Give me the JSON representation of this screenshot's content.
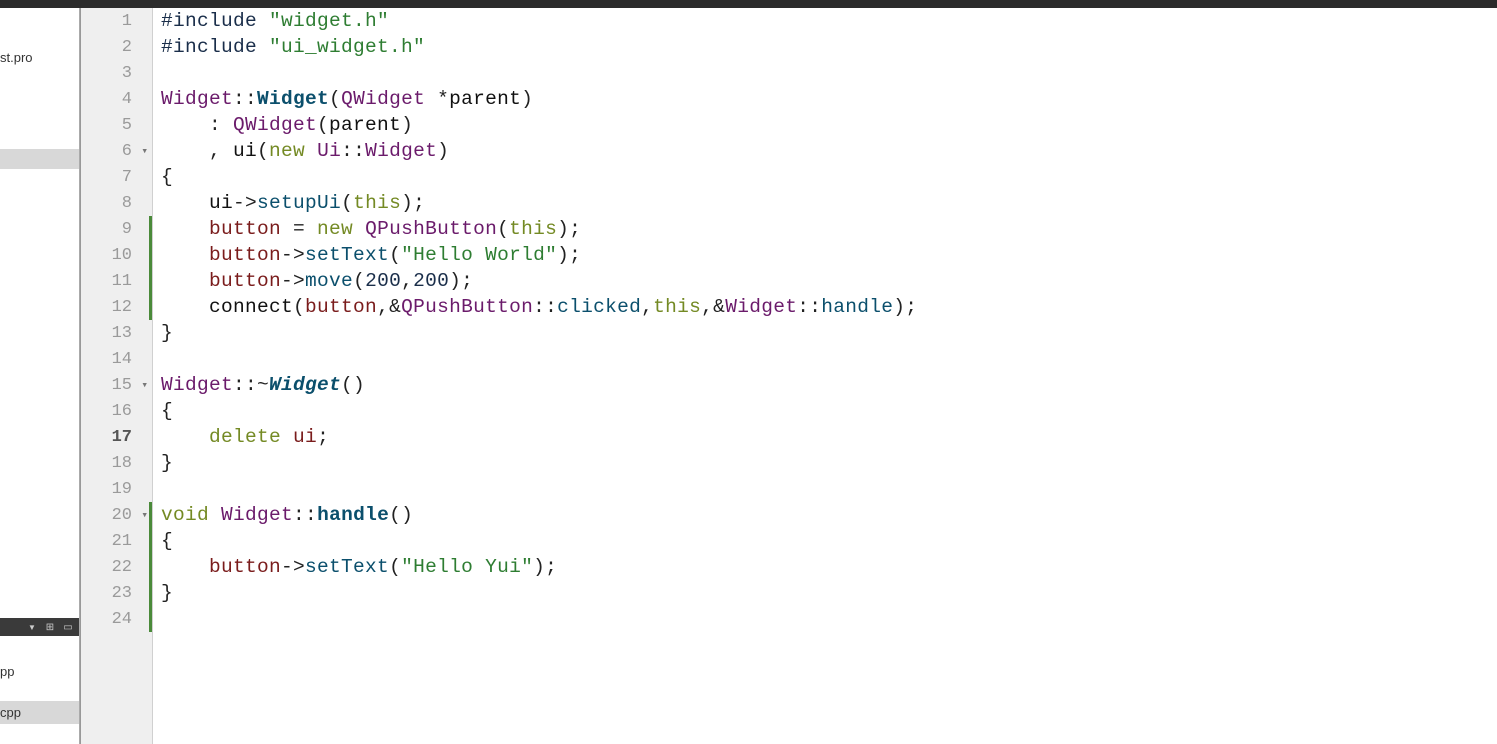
{
  "sidebar": {
    "items": [
      {
        "label": "st.pro",
        "selected": false
      },
      {
        "label": "",
        "selected": true
      }
    ],
    "lower": [
      {
        "label": "pp",
        "selected": false
      },
      {
        "label": "cpp",
        "selected": true
      }
    ]
  },
  "editor": {
    "current_line": 17,
    "lines": [
      {
        "n": 1,
        "fold": false,
        "changed": false,
        "tokens": [
          [
            "preproc",
            "#include"
          ],
          [
            "op",
            " "
          ],
          [
            "string",
            "\"widget.h\""
          ]
        ]
      },
      {
        "n": 2,
        "fold": false,
        "changed": false,
        "tokens": [
          [
            "preproc",
            "#include"
          ],
          [
            "op",
            " "
          ],
          [
            "string",
            "\"ui_widget.h\""
          ]
        ]
      },
      {
        "n": 3,
        "fold": false,
        "changed": false,
        "tokens": []
      },
      {
        "n": 4,
        "fold": false,
        "changed": false,
        "tokens": [
          [
            "type",
            "Widget"
          ],
          [
            "op",
            "::"
          ],
          [
            "funcbold",
            "Widget"
          ],
          [
            "op",
            "("
          ],
          [
            "type",
            "QWidget"
          ],
          [
            "op",
            " *"
          ],
          [
            "ident",
            "parent"
          ],
          [
            "op",
            ")"
          ]
        ]
      },
      {
        "n": 5,
        "fold": false,
        "changed": false,
        "tokens": [
          [
            "op",
            "    : "
          ],
          [
            "type",
            "QWidget"
          ],
          [
            "op",
            "("
          ],
          [
            "ident",
            "parent"
          ],
          [
            "op",
            ")"
          ]
        ]
      },
      {
        "n": 6,
        "fold": true,
        "changed": false,
        "tokens": [
          [
            "op",
            "    , "
          ],
          [
            "ident",
            "ui"
          ],
          [
            "op",
            "("
          ],
          [
            "keyword",
            "new"
          ],
          [
            "op",
            " "
          ],
          [
            "type",
            "Ui"
          ],
          [
            "op",
            "::"
          ],
          [
            "type",
            "Widget"
          ],
          [
            "op",
            ")"
          ]
        ]
      },
      {
        "n": 7,
        "fold": false,
        "changed": false,
        "tokens": [
          [
            "op",
            "{"
          ]
        ]
      },
      {
        "n": 8,
        "fold": false,
        "changed": false,
        "tokens": [
          [
            "op",
            "    "
          ],
          [
            "ident",
            "ui"
          ],
          [
            "op",
            "->"
          ],
          [
            "func",
            "setupUi"
          ],
          [
            "op",
            "("
          ],
          [
            "keyword",
            "this"
          ],
          [
            "op",
            ");"
          ]
        ]
      },
      {
        "n": 9,
        "fold": false,
        "changed": true,
        "tokens": [
          [
            "op",
            "    "
          ],
          [
            "var",
            "button"
          ],
          [
            "op",
            " = "
          ],
          [
            "keyword",
            "new"
          ],
          [
            "op",
            " "
          ],
          [
            "type",
            "QPushButton"
          ],
          [
            "op",
            "("
          ],
          [
            "keyword",
            "this"
          ],
          [
            "op",
            ");"
          ]
        ]
      },
      {
        "n": 10,
        "fold": false,
        "changed": true,
        "tokens": [
          [
            "op",
            "    "
          ],
          [
            "var",
            "button"
          ],
          [
            "op",
            "->"
          ],
          [
            "func",
            "setText"
          ],
          [
            "op",
            "("
          ],
          [
            "string",
            "\"Hello World\""
          ],
          [
            "op",
            ");"
          ]
        ]
      },
      {
        "n": 11,
        "fold": false,
        "changed": true,
        "tokens": [
          [
            "op",
            "    "
          ],
          [
            "var",
            "button"
          ],
          [
            "op",
            "->"
          ],
          [
            "func",
            "move"
          ],
          [
            "op",
            "("
          ],
          [
            "number",
            "200"
          ],
          [
            "op",
            ","
          ],
          [
            "number",
            "200"
          ],
          [
            "op",
            ");"
          ]
        ]
      },
      {
        "n": 12,
        "fold": false,
        "changed": true,
        "tokens": [
          [
            "op",
            "    "
          ],
          [
            "ident",
            "connect"
          ],
          [
            "op",
            "("
          ],
          [
            "var",
            "button"
          ],
          [
            "op",
            ",&"
          ],
          [
            "type",
            "QPushButton"
          ],
          [
            "op",
            "::"
          ],
          [
            "func",
            "clicked"
          ],
          [
            "op",
            ","
          ],
          [
            "keyword",
            "this"
          ],
          [
            "op",
            ",&"
          ],
          [
            "type",
            "Widget"
          ],
          [
            "op",
            "::"
          ],
          [
            "func",
            "handle"
          ],
          [
            "op",
            ");"
          ]
        ]
      },
      {
        "n": 13,
        "fold": false,
        "changed": false,
        "tokens": [
          [
            "op",
            "}"
          ]
        ]
      },
      {
        "n": 14,
        "fold": false,
        "changed": false,
        "tokens": []
      },
      {
        "n": 15,
        "fold": true,
        "changed": false,
        "tokens": [
          [
            "type",
            "Widget"
          ],
          [
            "op",
            "::~"
          ],
          [
            "funcital",
            "Widget"
          ],
          [
            "op",
            "()"
          ]
        ]
      },
      {
        "n": 16,
        "fold": false,
        "changed": false,
        "tokens": [
          [
            "op",
            "{"
          ]
        ]
      },
      {
        "n": 17,
        "fold": false,
        "changed": false,
        "tokens": [
          [
            "op",
            "    "
          ],
          [
            "keyword",
            "delete"
          ],
          [
            "op",
            " "
          ],
          [
            "var",
            "ui"
          ],
          [
            "op",
            ";"
          ]
        ]
      },
      {
        "n": 18,
        "fold": false,
        "changed": false,
        "tokens": [
          [
            "op",
            "}"
          ]
        ]
      },
      {
        "n": 19,
        "fold": false,
        "changed": false,
        "tokens": []
      },
      {
        "n": 20,
        "fold": true,
        "changed": true,
        "tokens": [
          [
            "keyword",
            "void"
          ],
          [
            "op",
            " "
          ],
          [
            "type",
            "Widget"
          ],
          [
            "op",
            "::"
          ],
          [
            "funcbold",
            "handle"
          ],
          [
            "op",
            "()"
          ]
        ]
      },
      {
        "n": 21,
        "fold": false,
        "changed": true,
        "tokens": [
          [
            "op",
            "{"
          ]
        ]
      },
      {
        "n": 22,
        "fold": false,
        "changed": true,
        "tokens": [
          [
            "op",
            "    "
          ],
          [
            "var",
            "button"
          ],
          [
            "op",
            "->"
          ],
          [
            "func",
            "setText"
          ],
          [
            "op",
            "("
          ],
          [
            "string",
            "\"Hello Yui\""
          ],
          [
            "op",
            ");"
          ]
        ]
      },
      {
        "n": 23,
        "fold": false,
        "changed": true,
        "tokens": [
          [
            "op",
            "}"
          ]
        ]
      },
      {
        "n": 24,
        "fold": false,
        "changed": true,
        "tokens": []
      }
    ]
  }
}
